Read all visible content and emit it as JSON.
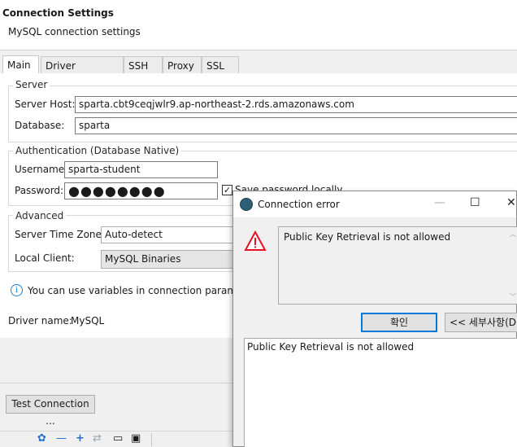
{
  "header": {
    "title": "Connection Settings",
    "subtitle": "MySQL connection settings"
  },
  "tabs": [
    {
      "label": "Main",
      "active": true
    },
    {
      "label": "Driver properties"
    },
    {
      "label": "SSH"
    },
    {
      "label": "Proxy"
    },
    {
      "label": "SSL"
    }
  ],
  "server": {
    "group_title": "Server",
    "host_label": "Server Host:",
    "host_value": "sparta.cbt9ceqjwlr9.ap-northeast-2.rds.amazonaws.com",
    "database_label": "Database:",
    "database_value": "sparta"
  },
  "auth": {
    "group_title": "Authentication (Database Native)",
    "username_label": "Username:",
    "username_value": "sparta-student",
    "password_label": "Password:",
    "password_mask": "●●●●●●●●",
    "save_password_label": "Save password locally",
    "save_password_checked": true
  },
  "advanced": {
    "group_title": "Advanced",
    "timezone_label": "Server Time Zone:",
    "timezone_value": "Auto-detect",
    "client_label": "Local Client:",
    "client_value": "MySQL Binaries"
  },
  "info_text": "You can use variables in connection parameters",
  "driver": {
    "label": "Driver name:",
    "value": "MySQL"
  },
  "test_connection_label": "Test Connection ...",
  "dialog": {
    "title": "Connection error",
    "message": "Public Key Retrieval is not allowed",
    "ok_label": "확인",
    "details_label": "<< 세부사항(D)",
    "details_text": "Public Key Retrieval is not allowed"
  },
  "colors": {
    "accent": "#0078d7",
    "error": "#e81123",
    "info": "#1e7fd6",
    "toolbar_icon": "#1f6fc5"
  },
  "icons": {
    "error": "warning-triangle-icon",
    "info": "info-circle-icon"
  }
}
